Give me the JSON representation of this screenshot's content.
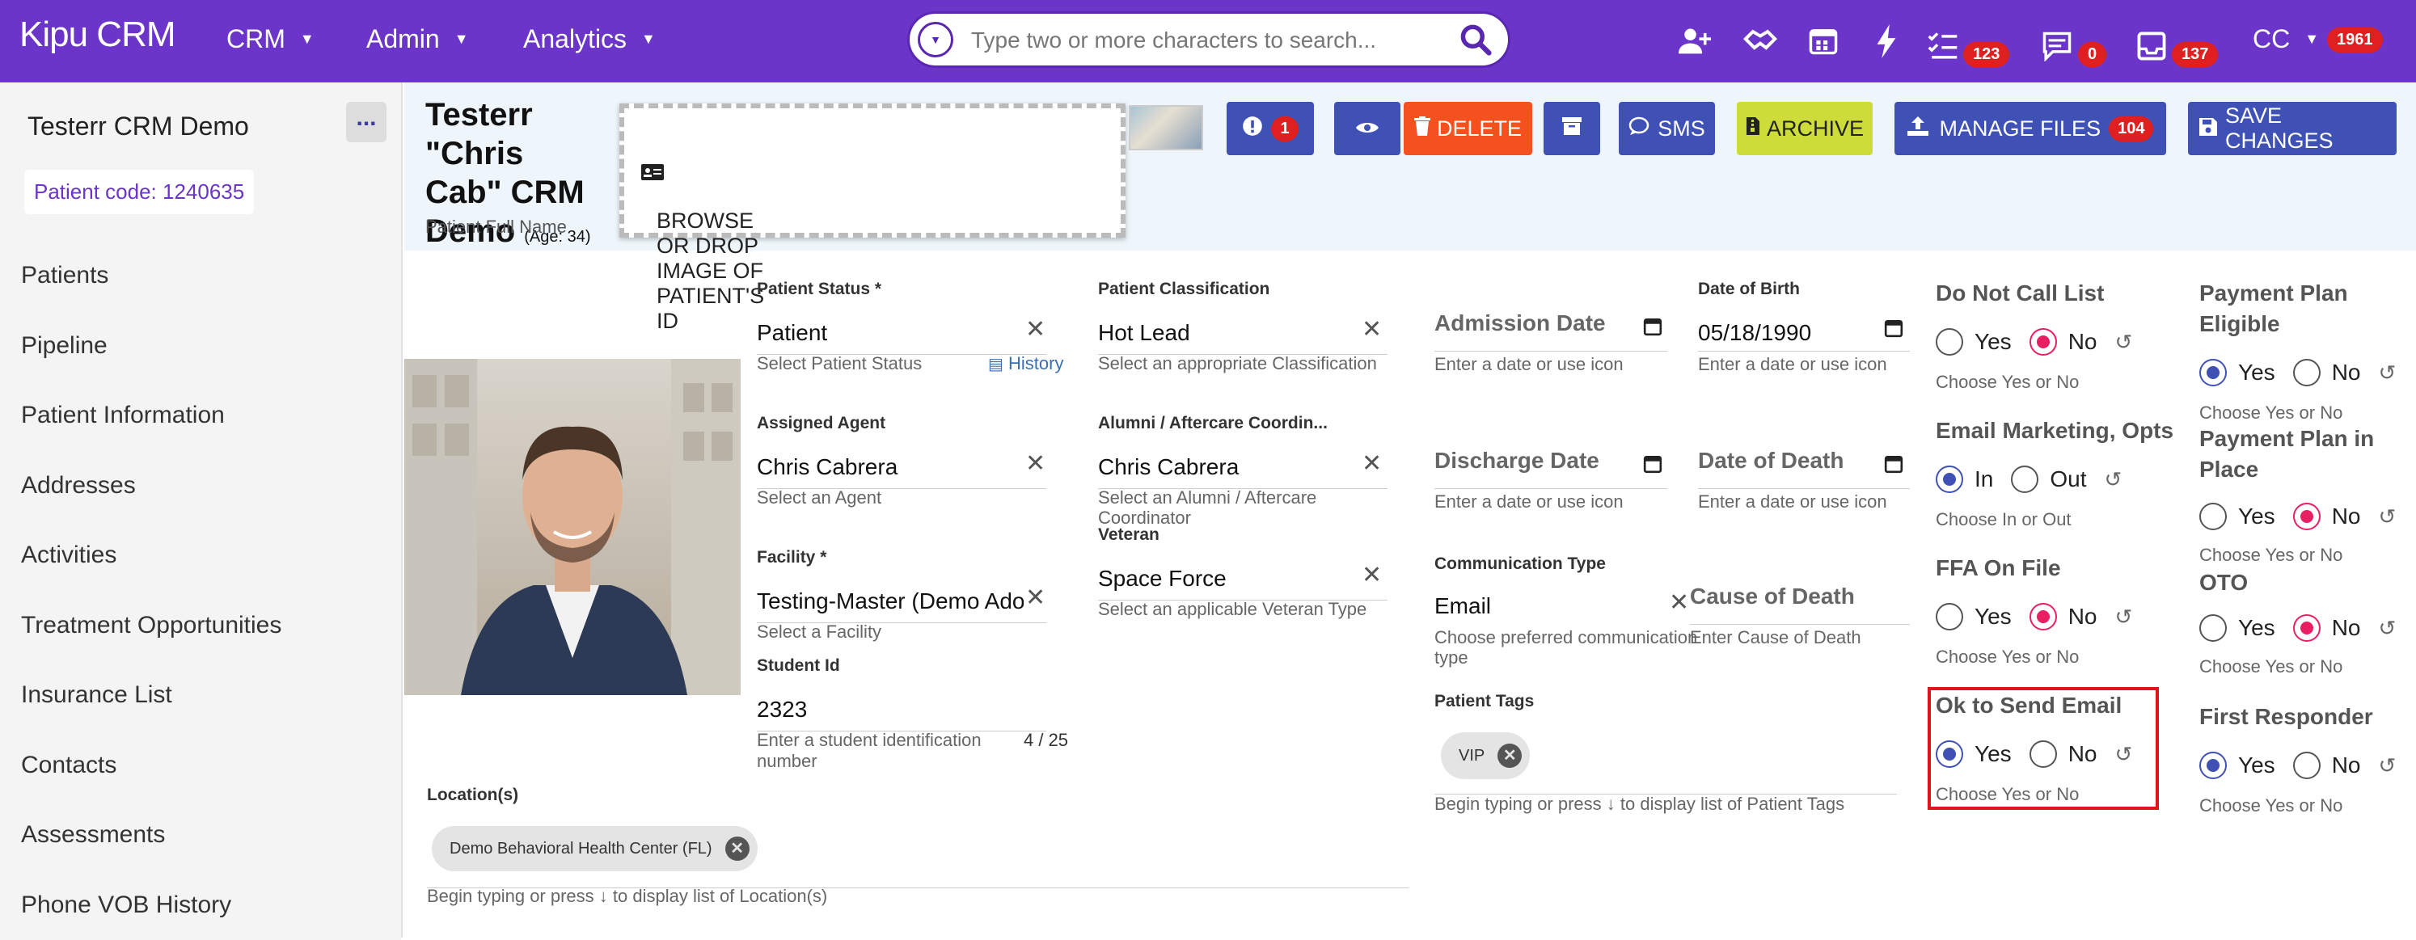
{
  "topbar": {
    "logo": "Kipu CRM",
    "nav": [
      {
        "label": "CRM"
      },
      {
        "label": "Admin"
      },
      {
        "label": "Analytics"
      }
    ],
    "search_placeholder": "Type two or more characters to search...",
    "icons": [
      {
        "name": "add-user-icon",
        "badge": ""
      },
      {
        "name": "handshake-icon",
        "badge": ""
      },
      {
        "name": "calendar-icon",
        "badge": ""
      },
      {
        "name": "bolt-icon",
        "badge": ""
      },
      {
        "name": "checklist-icon",
        "badge": "123"
      },
      {
        "name": "messages-icon",
        "badge": "0"
      },
      {
        "name": "inbox-icon",
        "badge": "137"
      }
    ],
    "user": {
      "initials": "CC",
      "badge": "1961"
    },
    "bg_color": "#6a35c8"
  },
  "sidebar": {
    "title": "Testerr CRM Demo",
    "more": "...",
    "patient_code": "Patient code: 1240635",
    "items": [
      "Patients",
      "Pipeline",
      "Patient Information",
      "Addresses",
      "Activities",
      "Treatment Opportunities",
      "Insurance List",
      "Contacts",
      "Assessments",
      "Phone VOB History"
    ]
  },
  "header": {
    "name_line1": "Testerr \"Chris",
    "name_line2": "Cab\" CRM",
    "name_line3": "Demo",
    "age": "(Age: 34)",
    "subtitle": "Patient Full Name",
    "dropzone": "BROWSE OR DROP IMAGE OF PATIENT'S ID",
    "buttons": {
      "alerts_count": "1",
      "delete": "DELETE",
      "sms": "SMS",
      "archive": "ARCHIVE",
      "manage_files": "MANAGE FILES",
      "manage_files_count": "104",
      "save": "SAVE CHANGES"
    },
    "colors": {
      "primary": "#3f51b5",
      "delete": "#f4511e",
      "archive": "#cddc39"
    }
  },
  "fields": {
    "patient_status": {
      "label": "Patient Status",
      "value": "Patient",
      "hint": "Select Patient Status",
      "history": "History"
    },
    "classification": {
      "label": "Patient Classification",
      "value": "Hot Lead",
      "hint": "Select an appropriate Classification"
    },
    "assigned_agent": {
      "label": "Assigned Agent",
      "value": "Chris Cabrera",
      "hint": "Select an Agent"
    },
    "alumni": {
      "label": "Alumni / Aftercare Coordin...",
      "value": "Chris Cabrera",
      "hint1": "Select an Alumni / Aftercare",
      "hint2": "Coordinator"
    },
    "facility": {
      "label": "Facility",
      "value": "Testing-Master (Demo Adol",
      "hint": "Select a Facility"
    },
    "veteran": {
      "label": "Veteran",
      "value": "Space Force",
      "hint": "Select an applicable Veteran Type"
    },
    "student_id": {
      "label": "Student Id",
      "value": "2323",
      "hint1": "Enter a student identification",
      "hint2": "number",
      "counter": "4 / 25"
    },
    "admission_date": {
      "value": "Admission Date",
      "hint": "Enter a date or use icon"
    },
    "dob": {
      "label": "Date of Birth",
      "value": "05/18/1990",
      "hint": "Enter a date or use icon"
    },
    "discharge_date": {
      "value": "Discharge Date",
      "hint": "Enter a date or use icon"
    },
    "dod": {
      "value": "Date of Death",
      "hint": "Enter a date or use icon"
    },
    "comm_type": {
      "label": "Communication Type",
      "value": "Email",
      "hint1": "Choose preferred communication",
      "hint2": "type"
    },
    "cause_death": {
      "value": "Cause of Death",
      "hint": "Enter Cause of Death"
    },
    "tags": {
      "label": "Patient Tags",
      "chip": "VIP",
      "hint": "Begin typing or press ↓ to display list of Patient Tags"
    },
    "locations": {
      "label": "Location(s)",
      "chip": "Demo Behavioral Health Center (FL)",
      "hint": "Begin typing or press ↓ to display list of Location(s)"
    }
  },
  "radios": {
    "dnc": {
      "title": "Do Not Call List",
      "a": "Yes",
      "b": "No",
      "hint": "Choose Yes or No"
    },
    "email_marketing": {
      "title": "Email Marketing, Opts",
      "a": "In",
      "b": "Out",
      "hint": "Choose In or Out"
    },
    "ffa": {
      "title": "FFA On File",
      "a": "Yes",
      "b": "No",
      "hint": "Choose Yes or No"
    },
    "ok_email": {
      "title": "Ok to Send Email",
      "a": "Yes",
      "b": "No",
      "hint": "Choose Yes or No"
    },
    "pp_eligible": {
      "title1": "Payment Plan",
      "title2": "Eligible",
      "a": "Yes",
      "b": "No",
      "hint": "Choose Yes or No"
    },
    "pp_place": {
      "title1": "Payment Plan in",
      "title2": "Place",
      "a": "Yes",
      "b": "No",
      "hint": "Choose Yes or No"
    },
    "oto": {
      "title": "OTO",
      "a": "Yes",
      "b": "No",
      "hint": "Choose Yes or No"
    },
    "first_responder": {
      "title": "First Responder",
      "a": "Yes",
      "b": "No",
      "hint": "Choose Yes or No"
    }
  }
}
